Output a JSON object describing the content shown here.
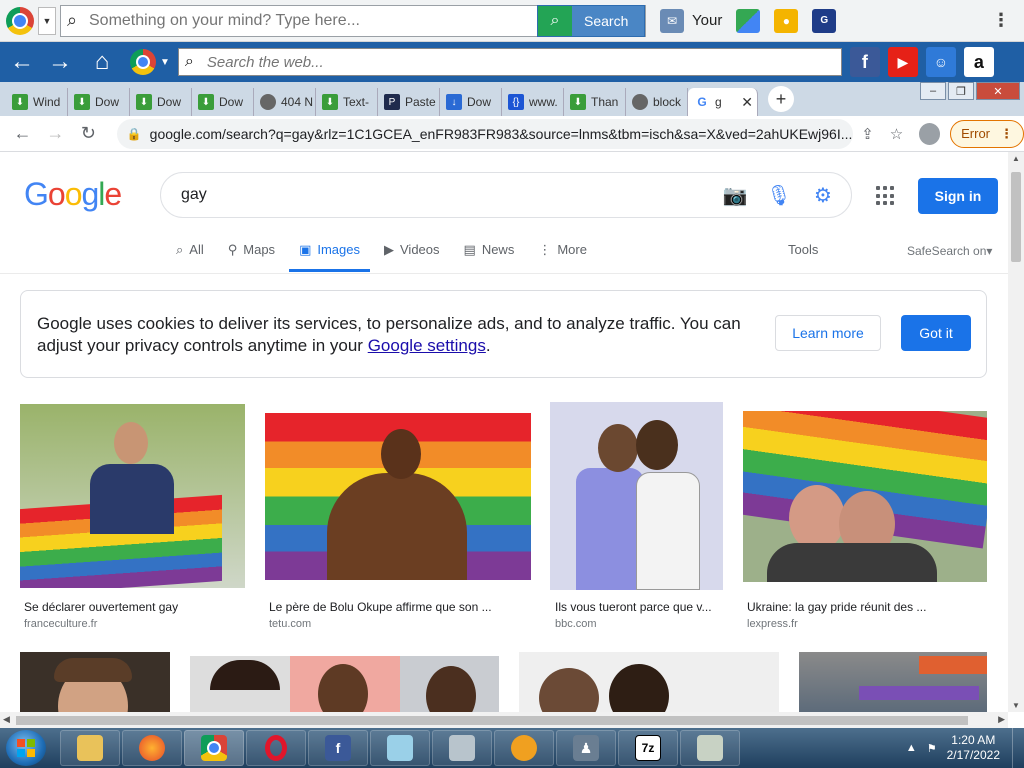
{
  "topbar": {
    "search_placeholder": "Something on your mind? Type here...",
    "search_button": "Search",
    "your_label": "Your"
  },
  "navbar": {
    "web_search_placeholder": "Search the web..."
  },
  "tabs": [
    {
      "label": "Wind",
      "icon": "download-icon"
    },
    {
      "label": "Dow",
      "icon": "download-icon"
    },
    {
      "label": "Dow",
      "icon": "download-icon"
    },
    {
      "label": "Dow",
      "icon": "download-icon"
    },
    {
      "label": "404 N",
      "icon": "globe-icon"
    },
    {
      "label": "Text-",
      "icon": "download-icon"
    },
    {
      "label": "Paste",
      "icon": "paste-icon"
    },
    {
      "label": "Dow",
      "icon": "download-arrow-icon"
    },
    {
      "label": "www.",
      "icon": "code-icon"
    },
    {
      "label": "Than",
      "icon": "download-icon"
    },
    {
      "label": "block",
      "icon": "globe-icon"
    },
    {
      "label": "g",
      "icon": "google-icon",
      "active": true
    }
  ],
  "address": {
    "url": "google.com/search?q=gay&rlz=1C1GCEA_enFR983FR983&source=lnms&tbm=isch&sa=X&ved=2ahUKEwj96I...",
    "error_label": "Error"
  },
  "google": {
    "logo_letters": [
      "G",
      "o",
      "o",
      "g",
      "l",
      "e"
    ],
    "query": "gay",
    "sign_in": "Sign in",
    "filters": [
      {
        "label": "All",
        "icon": "search-icon"
      },
      {
        "label": "Maps",
        "icon": "map-pin-icon"
      },
      {
        "label": "Images",
        "icon": "image-icon",
        "active": true
      },
      {
        "label": "Videos",
        "icon": "video-icon"
      },
      {
        "label": "News",
        "icon": "news-icon"
      },
      {
        "label": "More",
        "icon": "more-dots-icon"
      }
    ],
    "tools": "Tools",
    "safesearch": "SafeSearch on"
  },
  "cookie": {
    "text_before": "Google uses cookies to deliver its services, to personalize ads, and to analyze traffic. You can adjust your privacy controls anytime in your ",
    "link": "Google settings",
    "text_after": ".",
    "learn_more": "Learn more",
    "got_it": "Got it"
  },
  "results": [
    {
      "caption": "Se déclarer ouvertement gay",
      "source": "franceculture.fr"
    },
    {
      "caption": "Le père de Bolu Okupe affirme que son ...",
      "source": "tetu.com"
    },
    {
      "caption": "Ils vous tueront parce que v...",
      "source": "bbc.com"
    },
    {
      "caption": "Ukraine: la gay pride réunit des ...",
      "source": "lexpress.fr"
    }
  ],
  "taskbar": {
    "time": "1:20 AM",
    "date": "2/17/2022",
    "apps": [
      "explorer",
      "firefox",
      "chrome",
      "opera",
      "facebook",
      "notepad",
      "monitor",
      "vpn",
      "chess",
      "7zip",
      "tool"
    ]
  },
  "colors": {
    "google_blue": "#1a73e8",
    "link": "#1a0dab",
    "taskbar": "#1f3f5e"
  }
}
